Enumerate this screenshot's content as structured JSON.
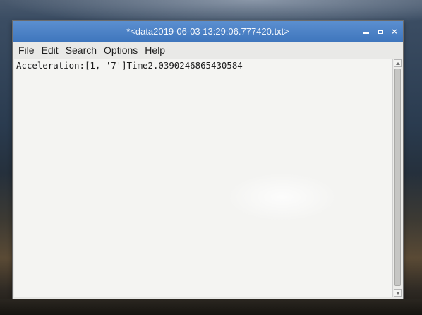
{
  "window": {
    "title": "*<data2019-06-03 13:29:06.777420.txt>"
  },
  "window_controls": {
    "minimize_icon": "minimize-icon",
    "maximize_icon": "maximize-icon",
    "close_icon": "close-icon",
    "close_glyph": "×"
  },
  "menu": {
    "items": [
      {
        "label": "File"
      },
      {
        "label": "Edit"
      },
      {
        "label": "Search"
      },
      {
        "label": "Options"
      },
      {
        "label": "Help"
      }
    ]
  },
  "editor": {
    "content": "Acceleration:[1, '7']Time2.0390246865430584"
  },
  "colors": {
    "titlebar": "#4a82c8",
    "window_bg": "#e7e7e5",
    "text_bg": "#f4f4f2"
  }
}
